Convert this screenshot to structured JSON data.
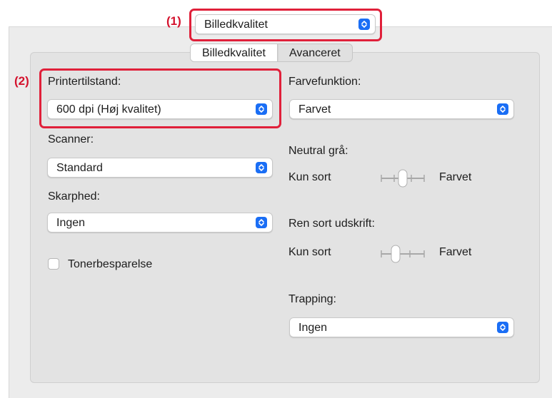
{
  "annotations": {
    "callout1": "(1)",
    "callout2": "(2)"
  },
  "top_popup": {
    "value": "Billedkvalitet",
    "icon": "chevron-updown-icon"
  },
  "tabs": [
    {
      "label": "Billedkvalitet",
      "selected": true
    },
    {
      "label": "Avanceret",
      "selected": false
    }
  ],
  "left": {
    "printer_mode": {
      "label": "Printertilstand:",
      "value": "600 dpi (Høj kvalitet)"
    },
    "scanner": {
      "label": "Scanner:",
      "value": "Standard"
    },
    "sharpness": {
      "label": "Skarphed:",
      "value": "Ingen"
    },
    "toner_saving": {
      "label": "Tonerbesparelse",
      "checked": false
    }
  },
  "right": {
    "color_function": {
      "label": "Farvefunktion:",
      "value": "Farvet"
    },
    "neutral_gray": {
      "label": "Neutral grå:",
      "min_label": "Kun sort",
      "max_label": "Farvet",
      "position": 0.5
    },
    "pure_black": {
      "label": "Ren sort udskrift:",
      "min_label": "Kun sort",
      "max_label": "Farvet",
      "position": 0.33
    },
    "trapping": {
      "label": "Trapping:",
      "value": "Ingen"
    }
  },
  "colors": {
    "accent": "#1a6ef5",
    "callout": "#e0203a"
  }
}
